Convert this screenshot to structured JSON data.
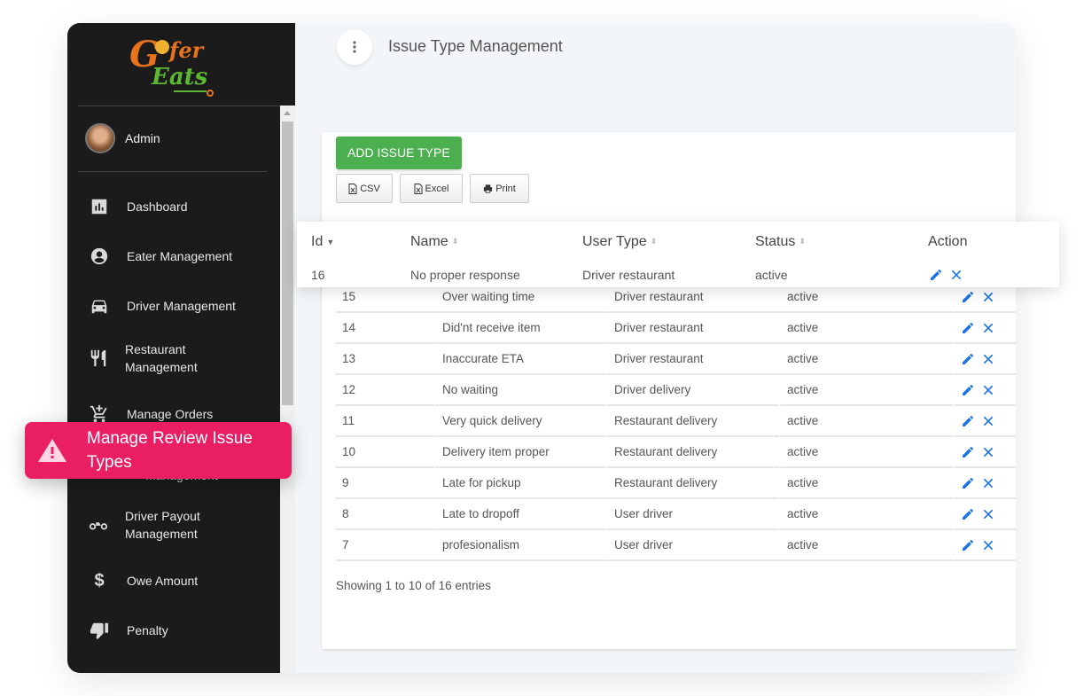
{
  "app": {
    "brand": "Gofer Eats"
  },
  "sidebar": {
    "user": {
      "name": "Admin"
    },
    "items": [
      {
        "label": "Dashboard",
        "icon": "bar-chart-icon"
      },
      {
        "label": "Eater Management",
        "icon": "account-circle-icon"
      },
      {
        "label": "Driver Management",
        "icon": "car-icon"
      },
      {
        "label": "Restaurant Management",
        "icon": "restaurant-icon"
      },
      {
        "label": "Manage Orders",
        "icon": "cart-add-icon"
      },
      {
        "label": "Management",
        "icon": "hidden-icon"
      },
      {
        "label": "Driver Payout Management",
        "icon": "motorcycle-icon"
      },
      {
        "label": "Owe Amount",
        "icon": "dollar-icon"
      },
      {
        "label": "Penalty",
        "icon": "thumb-down-icon"
      }
    ],
    "highlight": {
      "label": "Manage Review Issue Types",
      "icon": "warning-icon",
      "color": "#ea1f63"
    }
  },
  "header": {
    "title": "Issue Type Management"
  },
  "toolbar": {
    "add_label": "ADD ISSUE TYPE",
    "csv_label": "CSV",
    "excel_label": "Excel",
    "print_label": "Print"
  },
  "table": {
    "columns": [
      "Id",
      "Name",
      "User Type",
      "Status",
      "Action"
    ],
    "rows": [
      {
        "id": "16",
        "name": "No proper response",
        "user_type": "Driver restaurant",
        "status": "active"
      },
      {
        "id": "15",
        "name": "Over waiting time",
        "user_type": "Driver restaurant",
        "status": "active"
      },
      {
        "id": "14",
        "name": "Did'nt receive item",
        "user_type": "Driver restaurant",
        "status": "active"
      },
      {
        "id": "13",
        "name": "Inaccurate ETA",
        "user_type": "Driver restaurant",
        "status": "active"
      },
      {
        "id": "12",
        "name": "No waiting",
        "user_type": "Driver delivery",
        "status": "active"
      },
      {
        "id": "11",
        "name": "Very quick delivery",
        "user_type": "Restaurant delivery",
        "status": "active"
      },
      {
        "id": "10",
        "name": "Delivery item proper",
        "user_type": "Restaurant delivery",
        "status": "active"
      },
      {
        "id": "9",
        "name": "Late for pickup",
        "user_type": "Restaurant delivery",
        "status": "active"
      },
      {
        "id": "8",
        "name": "Late to dropoff",
        "user_type": "User driver",
        "status": "active"
      },
      {
        "id": "7",
        "name": "profesionalism",
        "user_type": "User driver",
        "status": "active"
      }
    ],
    "info": "Showing 1 to 10 of 16 entries"
  },
  "colors": {
    "accent_green": "#4caf50",
    "action_blue": "#1a73e8",
    "sidebar_bg": "#1b1b1b"
  }
}
